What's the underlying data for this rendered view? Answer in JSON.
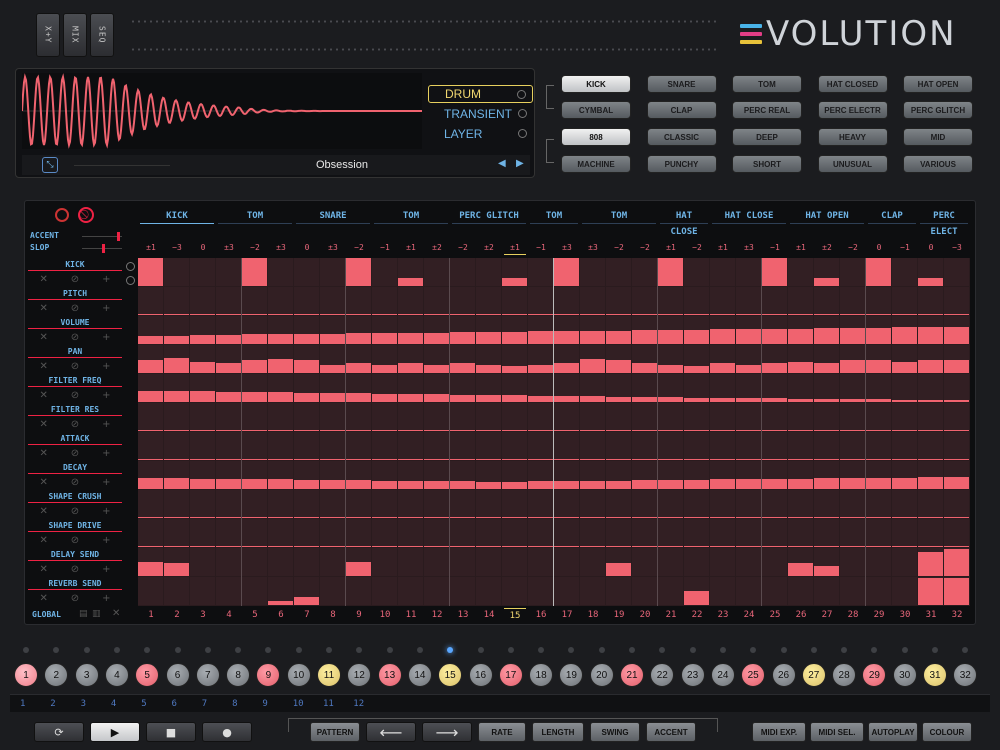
{
  "header": {
    "mode_buttons": [
      "X+Y",
      "MIX",
      "SEQ"
    ],
    "logo_text": "VOLUTION",
    "logo_colors": [
      "#49b3e8",
      "#e23d86",
      "#e8c23a"
    ]
  },
  "sound_panel": {
    "modes": [
      {
        "label": "DRUM",
        "active": true
      },
      {
        "label": "TRANSIENT",
        "active": false
      },
      {
        "label": "LAYER",
        "active": false
      }
    ],
    "preset_name": "Obsession",
    "arrow_left": "◀",
    "arrow_right": "▶"
  },
  "types": [
    [
      {
        "label": "KICK",
        "sel": true
      },
      {
        "label": "SNARE"
      },
      {
        "label": "TOM"
      },
      {
        "label": "HAT CLOSED"
      },
      {
        "label": "HAT OPEN"
      }
    ],
    [
      {
        "label": "CYMBAL"
      },
      {
        "label": "CLAP"
      },
      {
        "label": "PERC REAL"
      },
      {
        "label": "PERC ELECTR"
      },
      {
        "label": "PERC GLITCH"
      }
    ]
  ],
  "characters": [
    [
      {
        "label": "808",
        "sel": true
      },
      {
        "label": "CLASSIC"
      },
      {
        "label": "DEEP"
      },
      {
        "label": "HEAVY"
      },
      {
        "label": "MID"
      }
    ],
    [
      {
        "label": "MACHINE"
      },
      {
        "label": "PUNCHY"
      },
      {
        "label": "SHORT"
      },
      {
        "label": "UNUSUAL"
      },
      {
        "label": "VARIOUS"
      }
    ]
  ],
  "sequencer": {
    "accent_label": "ACCENT",
    "slop_label": "SLOP",
    "global_label": "GLOBAL",
    "lane_headers": [
      "KICK",
      "TOM",
      "SNARE",
      "TOM",
      "PERC GLITCH",
      "TOM",
      "TOM",
      "HAT CLOSE",
      "HAT CLOSE",
      "HAT OPEN",
      "CLAP",
      "PERC ELECT"
    ],
    "offsets": [
      "±1",
      "−3",
      "0",
      "±3",
      "−2",
      "±3",
      "0",
      "±3",
      "−2",
      "−1",
      "±1",
      "±2",
      "−2",
      "±2",
      "±1",
      "−1",
      "±3",
      "±3",
      "−2",
      "−2",
      "±1",
      "−2",
      "±1",
      "±3",
      "−1",
      "±1",
      "±2",
      "−2",
      "0",
      "−1",
      "0",
      "−3"
    ],
    "params": [
      "KICK",
      "PITCH",
      "VOLUME",
      "PAN",
      "FILTER FREQ",
      "FILTER RES",
      "ATTACK",
      "DECAY",
      "SHAPE CRUSH",
      "SHAPE DRIVE",
      "DELAY SEND",
      "REVERB SEND"
    ],
    "param_levels": {
      "KICK": [
        1,
        0,
        0,
        0,
        1,
        0,
        0,
        0,
        1,
        0,
        0.3,
        0,
        0,
        0,
        0.3,
        0,
        1,
        0,
        0,
        0,
        1,
        0,
        0,
        0,
        1,
        0,
        0.3,
        0,
        1,
        0,
        0.3,
        0
      ],
      "PITCH": [
        0.02,
        0.02,
        0.02,
        0.02,
        0.02,
        0.02,
        0.02,
        0.02,
        0.02,
        0.02,
        0.02,
        0.02,
        0.02,
        0.02,
        0.02,
        0.02,
        0.02,
        0.02,
        0.02,
        0.02,
        0.02,
        0.02,
        0.02,
        0.02,
        0.02,
        0.02,
        0.02,
        0.02,
        0.02,
        0.02,
        0.02,
        0.02
      ],
      "VOLUME": [
        0.3,
        0.3,
        0.32,
        0.33,
        0.34,
        0.35,
        0.36,
        0.37,
        0.38,
        0.39,
        0.4,
        0.41,
        0.42,
        0.43,
        0.44,
        0.45,
        0.46,
        0.47,
        0.48,
        0.49,
        0.5,
        0.51,
        0.52,
        0.53,
        0.54,
        0.55,
        0.56,
        0.57,
        0.58,
        0.59,
        0.6,
        0.62
      ],
      "PAN": [
        0.45,
        0.55,
        0.4,
        0.35,
        0.45,
        0.5,
        0.45,
        0.3,
        0.35,
        0.3,
        0.35,
        0.3,
        0.35,
        0.3,
        0.25,
        0.3,
        0.35,
        0.5,
        0.45,
        0.35,
        0.3,
        0.25,
        0.35,
        0.3,
        0.35,
        0.4,
        0.35,
        0.45,
        0.45,
        0.4,
        0.45,
        0.45
      ],
      "FILTER FREQ": [
        0.4,
        0.4,
        0.38,
        0.37,
        0.36,
        0.34,
        0.33,
        0.32,
        0.31,
        0.3,
        0.28,
        0.27,
        0.26,
        0.25,
        0.24,
        0.23,
        0.22,
        0.2,
        0.19,
        0.18,
        0.17,
        0.16,
        0.15,
        0.14,
        0.13,
        0.12,
        0.11,
        0.1,
        0.09,
        0.08,
        0.07,
        0.06
      ],
      "FILTER RES": [
        0.05,
        0.05,
        0.05,
        0.05,
        0.05,
        0.05,
        0.05,
        0.05,
        0.05,
        0.05,
        0.05,
        0.05,
        0.05,
        0.05,
        0.05,
        0.05,
        0.05,
        0.05,
        0.05,
        0.05,
        0.05,
        0.05,
        0.05,
        0.05,
        0.05,
        0.05,
        0.05,
        0.05,
        0.05,
        0.05,
        0.05,
        0.05
      ],
      "ATTACK": [
        0.05,
        0.05,
        0.05,
        0.05,
        0.05,
        0.05,
        0.05,
        0.05,
        0.05,
        0.05,
        0.05,
        0.05,
        0.05,
        0.05,
        0.05,
        0.05,
        0.05,
        0.05,
        0.05,
        0.05,
        0.05,
        0.05,
        0.05,
        0.05,
        0.05,
        0.05,
        0.05,
        0.05,
        0.05,
        0.05,
        0.05,
        0.05
      ],
      "DECAY": [
        0.4,
        0.38,
        0.37,
        0.36,
        0.35,
        0.34,
        0.33,
        0.32,
        0.31,
        0.3,
        0.29,
        0.28,
        0.27,
        0.26,
        0.26,
        0.27,
        0.28,
        0.29,
        0.3,
        0.31,
        0.32,
        0.33,
        0.34,
        0.35,
        0.36,
        0.37,
        0.38,
        0.39,
        0.4,
        0.41,
        0.42,
        0.44
      ],
      "SHAPE CRUSH": [
        0.05,
        0.05,
        0.05,
        0.05,
        0.05,
        0.05,
        0.05,
        0.05,
        0.05,
        0.05,
        0.05,
        0.05,
        0.05,
        0.05,
        0.05,
        0.05,
        0.05,
        0.05,
        0.05,
        0.05,
        0.05,
        0.05,
        0.05,
        0.05,
        0.05,
        0.05,
        0.05,
        0.05,
        0.05,
        0.05,
        0.05,
        0.05
      ],
      "SHAPE DRIVE": [
        0.05,
        0.05,
        0.05,
        0.05,
        0.05,
        0.05,
        0.05,
        0.05,
        0.05,
        0.05,
        0.05,
        0.05,
        0.05,
        0.05,
        0.05,
        0.05,
        0.05,
        0.05,
        0.05,
        0.05,
        0.05,
        0.05,
        0.05,
        0.05,
        0.05,
        0.05,
        0.05,
        0.05,
        0.05,
        0.05,
        0.05,
        0.05
      ],
      "DELAY SEND": [
        0.5,
        0.45,
        0,
        0,
        0,
        0,
        0,
        0,
        0.5,
        0,
        0,
        0,
        0,
        0,
        0,
        0,
        0,
        0,
        0.45,
        0,
        0,
        0,
        0,
        0,
        0,
        0.45,
        0.35,
        0,
        0,
        0,
        0.85,
        0.95
      ],
      "REVERB SEND": [
        0,
        0,
        0,
        0,
        0,
        0.15,
        0.3,
        0,
        0,
        0,
        0,
        0,
        0,
        0,
        0,
        0,
        0,
        0,
        0,
        0,
        0,
        0.5,
        0,
        0,
        0,
        0,
        0,
        0,
        0,
        0,
        0.95,
        0.95
      ]
    },
    "steps": [
      "1",
      "2",
      "3",
      "4",
      "5",
      "6",
      "7",
      "8",
      "9",
      "10",
      "11",
      "12",
      "13",
      "14",
      "15",
      "16",
      "17",
      "18",
      "19",
      "20",
      "21",
      "22",
      "23",
      "24",
      "25",
      "26",
      "27",
      "28",
      "29",
      "30",
      "31",
      "32"
    ],
    "current_step": 15,
    "cell_color": "#f0636f",
    "cell_bg": "#321f23"
  },
  "pads": [
    {
      "label": "1",
      "style": "sel"
    },
    {
      "label": "2"
    },
    {
      "label": "3"
    },
    {
      "label": "4"
    },
    {
      "label": "5",
      "style": "red"
    },
    {
      "label": "6"
    },
    {
      "label": "7"
    },
    {
      "label": "8"
    },
    {
      "label": "9",
      "style": "red"
    },
    {
      "label": "10"
    },
    {
      "label": "11",
      "style": "yel"
    },
    {
      "label": "12"
    },
    {
      "label": "13",
      "style": "red"
    },
    {
      "label": "14"
    },
    {
      "label": "15",
      "style": "yel",
      "led": true
    },
    {
      "label": "16"
    },
    {
      "label": "17",
      "style": "red"
    },
    {
      "label": "18"
    },
    {
      "label": "19"
    },
    {
      "label": "20"
    },
    {
      "label": "21",
      "style": "red"
    },
    {
      "label": "22"
    },
    {
      "label": "23"
    },
    {
      "label": "24"
    },
    {
      "label": "25",
      "style": "red"
    },
    {
      "label": "26"
    },
    {
      "label": "27",
      "style": "yel"
    },
    {
      "label": "28"
    },
    {
      "label": "29",
      "style": "red"
    },
    {
      "label": "30"
    },
    {
      "label": "31",
      "style": "yel"
    },
    {
      "label": "32"
    }
  ],
  "patterns": [
    "1",
    "2",
    "3",
    "4",
    "5",
    "6",
    "7",
    "8",
    "9",
    "10",
    "11",
    "12"
  ],
  "transport": {
    "loop_icon": "⟳",
    "play_icon": "▶",
    "stop_icon": "■",
    "record_icon": "●",
    "pattern_label": "PATTERN",
    "left_arrow": "⟵",
    "right_arrow": "⟶",
    "rate_label": "RATE",
    "length_label": "LENGTH",
    "swing_label": "SWING",
    "accent_label": "ACCENT",
    "midi_exp_label": "MIDI EXP.",
    "midi_sel_label": "MIDI SEL.",
    "autoplay_label": "AUTOPLAY",
    "colour_label": "COLOUR"
  }
}
